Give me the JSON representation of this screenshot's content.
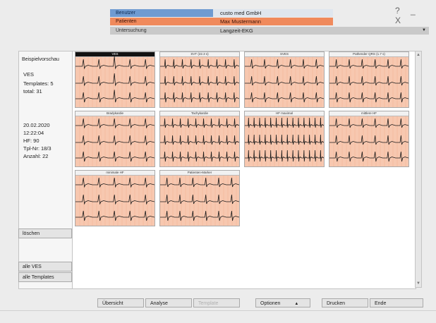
{
  "header": {
    "user_label": "Benutzer",
    "user_value": "custo med GmbH",
    "patient_label": "Patienten",
    "patient_value": "Max Mustermann",
    "exam_label": "Untersuchung",
    "exam_value": "Langzeit-EKG",
    "window_buttons": "? _ X"
  },
  "left": {
    "title": "Beispielvorschau",
    "type": "VES",
    "templates": "Templates: 5",
    "total": "total: 31",
    "date": "20.02.2020",
    "time": "12:22:04",
    "hf": "HF: 90",
    "tpl_nr": "Tpl-Nr: 18/3",
    "anzahl": "Anzahl: 22",
    "btn_delete": "löschen",
    "btn_all_ves": "alle VES",
    "btn_all_templates": "alle Templates"
  },
  "thumbnails": [
    {
      "title": "VES",
      "selected": true,
      "style": "ves"
    },
    {
      "title": "SVT (22.3 s)",
      "selected": false,
      "style": "svt"
    },
    {
      "title": "SVES",
      "selected": false,
      "style": "normal"
    },
    {
      "title": "Pathender QRS (1.7 s)",
      "selected": false,
      "style": "normal"
    },
    {
      "title": "Bradykardie",
      "selected": false,
      "style": "brady"
    },
    {
      "title": "Tachykardie",
      "selected": false,
      "style": "tachy"
    },
    {
      "title": "HF maximal",
      "selected": false,
      "style": "hfmax"
    },
    {
      "title": "mittlere HF",
      "selected": false,
      "style": "normal"
    },
    {
      "title": "minimale HF",
      "selected": false,
      "style": "brady"
    },
    {
      "title": "Patienten-Marker",
      "selected": false,
      "style": "normal"
    }
  ],
  "bottom": {
    "overview": "Übersicht",
    "analysis": "Analyse",
    "template": "Template",
    "options": "Optionen",
    "options_arrow": "▲",
    "print": "Drucken",
    "end": "Ende"
  },
  "colors": {
    "user_row": "#6f9bd1",
    "patient_row": "#f08a5c",
    "ecg_grid_bg": "#f7c8b0",
    "ecg_trace": "#1a1a1a"
  }
}
